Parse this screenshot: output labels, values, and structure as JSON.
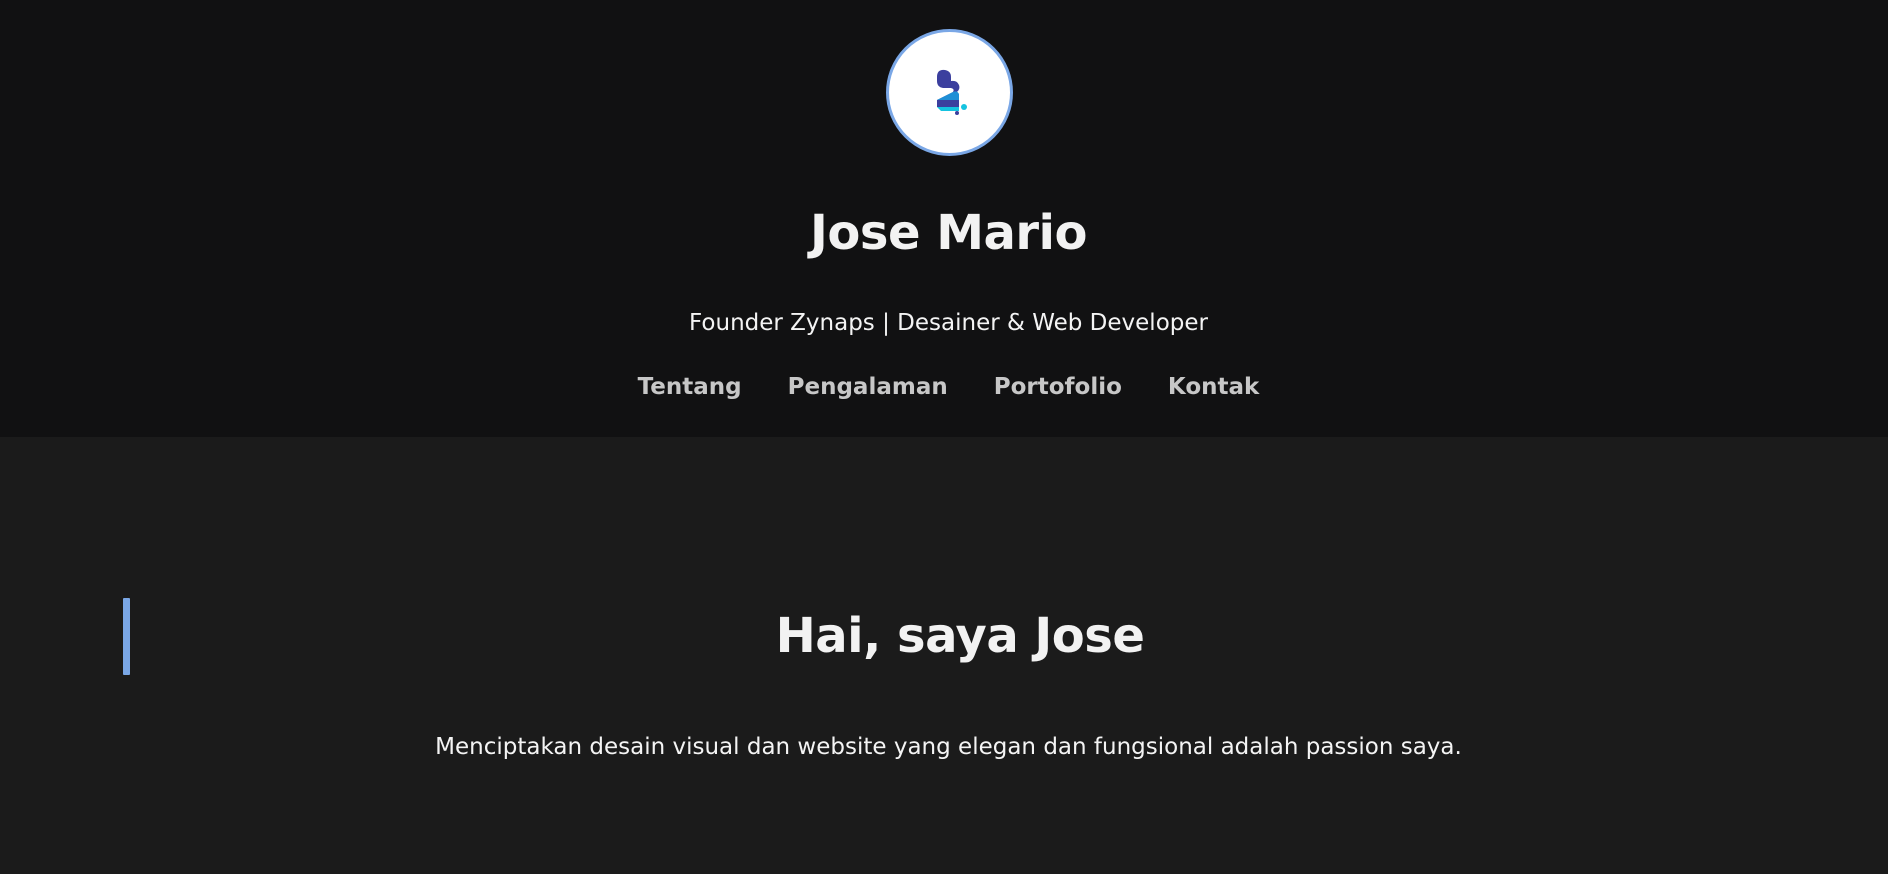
{
  "profile": {
    "logo": "zynaps-logo-icon",
    "name": "Jose Mario",
    "tagline": "Founder Zynaps | Desainer & Web Developer"
  },
  "nav": {
    "items": [
      "Tentang",
      "Pengalaman",
      "Portofolio",
      "Kontak"
    ]
  },
  "hero": {
    "heading": "Hai, saya Jose",
    "text": "Menciptakan desain visual dan website yang elegan dan fungsional adalah passion saya."
  },
  "colors": {
    "header_bg": "#111112",
    "body_bg": "#1b1b1b",
    "accent": "#7aa7e6",
    "logo_dark": "#3b3f9e",
    "logo_light": "#15c3e0"
  }
}
